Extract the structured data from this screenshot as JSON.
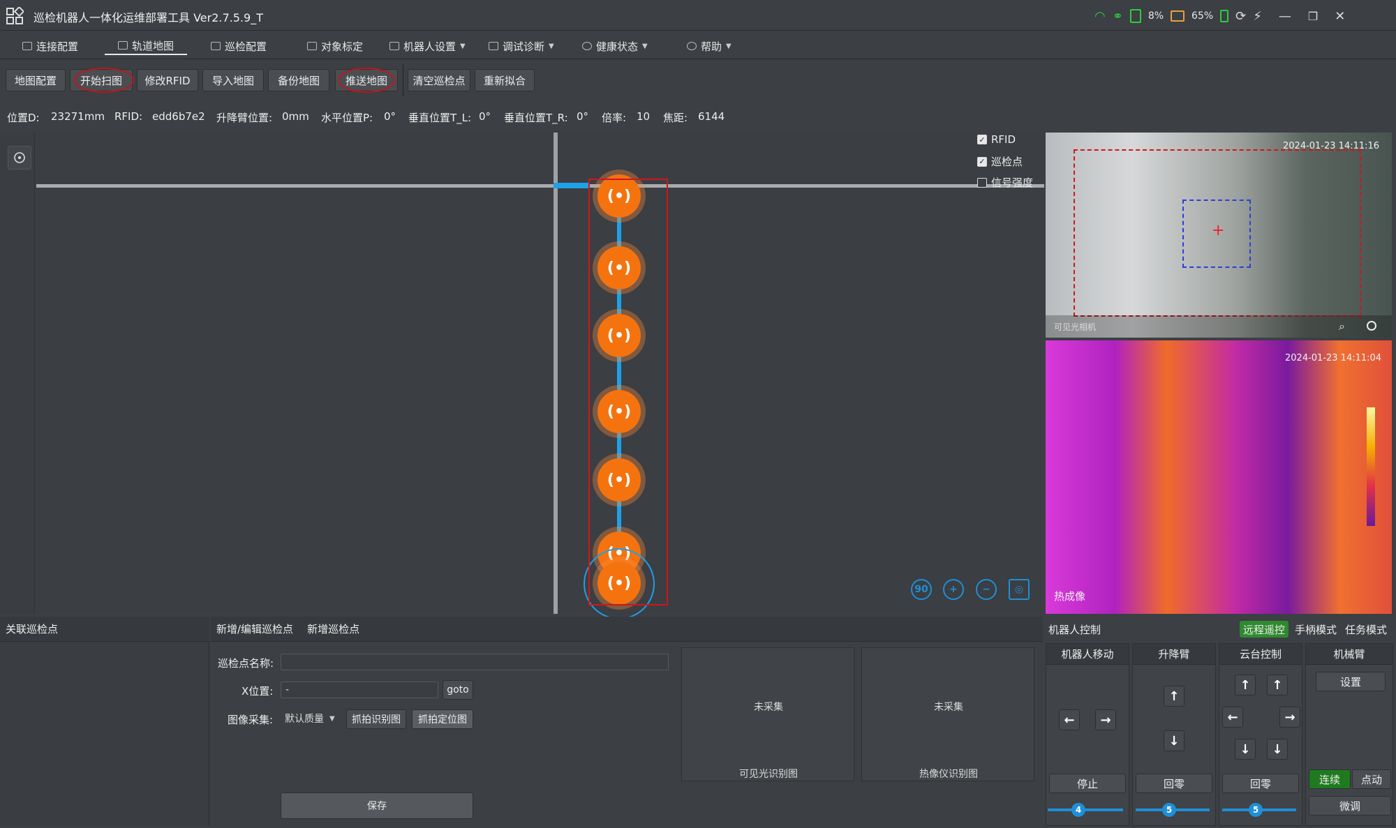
{
  "title": "巡检机器人一体化运维部署工具 Ver2.7.5.9_T",
  "status": {
    "wifi_icon": "wifi-icon",
    "battery1": "8%",
    "battery2": "65%"
  },
  "menu": [
    {
      "label": "连接配置"
    },
    {
      "label": "轨道地图"
    },
    {
      "label": "巡检配置"
    },
    {
      "label": "对象标定"
    },
    {
      "label": "机器人设置"
    },
    {
      "label": "调试诊断"
    },
    {
      "label": "健康状态"
    },
    {
      "label": "帮助"
    }
  ],
  "toolbar": [
    "地图配置",
    "开始扫图",
    "修改RFID",
    "导入地图",
    "备份地图",
    "推送地图",
    "清空巡检点",
    "重新拟合"
  ],
  "statusline": {
    "pos_label": "位置D:",
    "pos_value": "23271mm",
    "rfid_label": "RFID:",
    "rfid_value": "edd6b7e2",
    "lift_label": "升降臂位置:",
    "lift_value": "0mm",
    "hpos_label": "水平位置P:",
    "hpos_value": "0°",
    "vl_label": "垂直位置T_L:",
    "vl_value": "0°",
    "vr_label": "垂直位置T_R:",
    "vr_value": "0°",
    "zoom_label": "倍率:",
    "zoom_value": "10",
    "focus_label": "焦距:",
    "focus_value": "6144"
  },
  "map": {
    "checks": [
      {
        "label": "RFID",
        "checked": true
      },
      {
        "label": "巡检点",
        "checked": true
      },
      {
        "label": "信号强度",
        "checked": false
      }
    ],
    "rfid_glyph": "(•)"
  },
  "camera": {
    "visible_ts": "2024-01-23 14:11:16",
    "visible_label": "可见光相机",
    "thermal_ts": "2024-01-23 14:11:04",
    "thermal_label": "热成像"
  },
  "bottom": {
    "assoc_title": "关联巡检点",
    "edit_title": "新增/编辑巡检点",
    "add_title": "新增巡检点",
    "name_label": "巡检点名称:",
    "x_label": "X位置:",
    "x_value": "-",
    "goto": "goto",
    "capture_label": "图像采集:",
    "quality": "默认质量",
    "capture_recog": "抓拍识别图",
    "capture_locate": "抓拍定位图",
    "save": "保存",
    "img1_status": "未采集",
    "img1_label": "可见光识别图",
    "img2_status": "未采集",
    "img2_label": "热像仪识别图"
  },
  "control": {
    "title": "机器人控制",
    "modes": [
      "远程遥控",
      "手柄模式",
      "任务模式"
    ],
    "cols": [
      "机器人移动",
      "升降臂",
      "云台控制",
      "机械臂"
    ],
    "stop": "停止",
    "zero1": "回零",
    "zero2": "回零",
    "arm_set": "设置",
    "continuous": "连续",
    "jog": "点动",
    "fine": "微调",
    "speed1": "4",
    "speed2": "5",
    "speed3": "5"
  }
}
